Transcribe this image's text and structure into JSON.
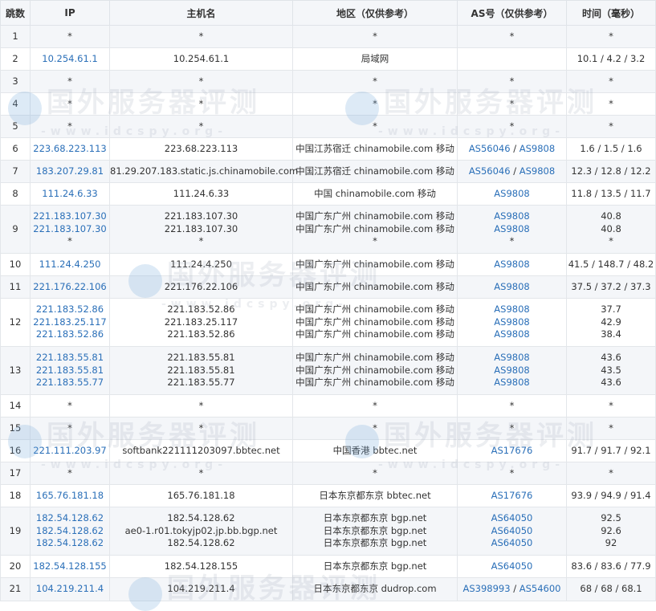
{
  "headers": [
    "跳数",
    "IP",
    "主机名",
    "地区（仅供参考）",
    "AS号（仅供参考）",
    "时间（毫秒）"
  ],
  "watermark": {
    "title": "国外服务器评测",
    "url": "-www.idcspy.org-"
  },
  "rows": [
    {
      "hop": "1",
      "ips": [
        "*"
      ],
      "hosts": [
        "*"
      ],
      "regions": [
        "*"
      ],
      "as": [
        [
          "*"
        ]
      ],
      "time": [
        "*"
      ]
    },
    {
      "hop": "2",
      "ips": [
        "10.254.61.1"
      ],
      "hosts": [
        "10.254.61.1"
      ],
      "regions": [
        "局域网"
      ],
      "as": [
        [
          ""
        ]
      ],
      "time": [
        "10.1 / 4.2 / 3.2"
      ]
    },
    {
      "hop": "3",
      "ips": [
        "*"
      ],
      "hosts": [
        "*"
      ],
      "regions": [
        "*"
      ],
      "as": [
        [
          "*"
        ]
      ],
      "time": [
        "*"
      ]
    },
    {
      "hop": "4",
      "ips": [
        "*"
      ],
      "hosts": [
        "*"
      ],
      "regions": [
        "*"
      ],
      "as": [
        [
          "*"
        ]
      ],
      "time": [
        "*"
      ]
    },
    {
      "hop": "5",
      "ips": [
        "*"
      ],
      "hosts": [
        "*"
      ],
      "regions": [
        "*"
      ],
      "as": [
        [
          "*"
        ]
      ],
      "time": [
        "*"
      ]
    },
    {
      "hop": "6",
      "ips": [
        "223.68.223.113"
      ],
      "hosts": [
        "223.68.223.113"
      ],
      "regions": [
        "中国江苏宿迁 chinamobile.com 移动"
      ],
      "as": [
        [
          "AS56046",
          "AS9808"
        ]
      ],
      "time": [
        "1.6 / 1.5 / 1.6"
      ]
    },
    {
      "hop": "7",
      "ips": [
        "183.207.29.81"
      ],
      "hosts": [
        "81.29.207.183.static.js.chinamobile.com"
      ],
      "regions": [
        "中国江苏宿迁 chinamobile.com 移动"
      ],
      "as": [
        [
          "AS56046",
          "AS9808"
        ]
      ],
      "time": [
        "12.3 / 12.8 / 12.2"
      ]
    },
    {
      "hop": "8",
      "ips": [
        "111.24.6.33"
      ],
      "hosts": [
        "111.24.6.33"
      ],
      "regions": [
        "中国 chinamobile.com 移动"
      ],
      "as": [
        [
          "AS9808"
        ]
      ],
      "time": [
        "11.8 / 13.5 / 11.7"
      ]
    },
    {
      "hop": "9",
      "ips": [
        "221.183.107.30",
        "221.183.107.30",
        "*"
      ],
      "hosts": [
        "221.183.107.30",
        "221.183.107.30",
        "*"
      ],
      "regions": [
        "中国广东广州 chinamobile.com 移动",
        "中国广东广州 chinamobile.com 移动",
        "*"
      ],
      "as": [
        [
          "AS9808"
        ],
        [
          "AS9808"
        ],
        [
          "*"
        ]
      ],
      "time": [
        "40.8",
        "40.8",
        "*"
      ]
    },
    {
      "hop": "10",
      "ips": [
        "111.24.4.250"
      ],
      "hosts": [
        "111.24.4.250"
      ],
      "regions": [
        "中国广东广州 chinamobile.com 移动"
      ],
      "as": [
        [
          "AS9808"
        ]
      ],
      "time": [
        "41.5 / 148.7 / 48.2"
      ]
    },
    {
      "hop": "11",
      "ips": [
        "221.176.22.106"
      ],
      "hosts": [
        "221.176.22.106"
      ],
      "regions": [
        "中国广东广州 chinamobile.com 移动"
      ],
      "as": [
        [
          "AS9808"
        ]
      ],
      "time": [
        "37.5 / 37.2 / 37.3"
      ]
    },
    {
      "hop": "12",
      "ips": [
        "221.183.52.86",
        "221.183.25.117",
        "221.183.52.86"
      ],
      "hosts": [
        "221.183.52.86",
        "221.183.25.117",
        "221.183.52.86"
      ],
      "regions": [
        "中国广东广州 chinamobile.com 移动",
        "中国广东广州 chinamobile.com 移动",
        "中国广东广州 chinamobile.com 移动"
      ],
      "as": [
        [
          "AS9808"
        ],
        [
          "AS9808"
        ],
        [
          "AS9808"
        ]
      ],
      "time": [
        "37.7",
        "42.9",
        "38.4"
      ]
    },
    {
      "hop": "13",
      "ips": [
        "221.183.55.81",
        "221.183.55.81",
        "221.183.55.77"
      ],
      "hosts": [
        "221.183.55.81",
        "221.183.55.81",
        "221.183.55.77"
      ],
      "regions": [
        "中国广东广州 chinamobile.com 移动",
        "中国广东广州 chinamobile.com 移动",
        "中国广东广州 chinamobile.com 移动"
      ],
      "as": [
        [
          "AS9808"
        ],
        [
          "AS9808"
        ],
        [
          "AS9808"
        ]
      ],
      "time": [
        "43.6",
        "43.5",
        "43.6"
      ]
    },
    {
      "hop": "14",
      "ips": [
        "*"
      ],
      "hosts": [
        "*"
      ],
      "regions": [
        "*"
      ],
      "as": [
        [
          "*"
        ]
      ],
      "time": [
        "*"
      ]
    },
    {
      "hop": "15",
      "ips": [
        "*"
      ],
      "hosts": [
        "*"
      ],
      "regions": [
        "*"
      ],
      "as": [
        [
          "*"
        ]
      ],
      "time": [
        "*"
      ]
    },
    {
      "hop": "16",
      "ips": [
        "221.111.203.97"
      ],
      "hosts": [
        "softbank221111203097.bbtec.net"
      ],
      "regions": [
        "中国香港 bbtec.net"
      ],
      "as": [
        [
          "AS17676"
        ]
      ],
      "time": [
        "91.7 / 91.7 / 92.1"
      ]
    },
    {
      "hop": "17",
      "ips": [
        "*"
      ],
      "hosts": [
        "*"
      ],
      "regions": [
        "*"
      ],
      "as": [
        [
          "*"
        ]
      ],
      "time": [
        "*"
      ]
    },
    {
      "hop": "18",
      "ips": [
        "165.76.181.18"
      ],
      "hosts": [
        "165.76.181.18"
      ],
      "regions": [
        "日本东京都东京 bbtec.net"
      ],
      "as": [
        [
          "AS17676"
        ]
      ],
      "time": [
        "93.9 / 94.9 / 91.4"
      ]
    },
    {
      "hop": "19",
      "ips": [
        "182.54.128.62",
        "182.54.128.62",
        "182.54.128.62"
      ],
      "hosts": [
        "182.54.128.62",
        "ae0-1.r01.tokyjp02.jp.bb.bgp.net",
        "182.54.128.62"
      ],
      "regions": [
        "日本东京都东京 bgp.net",
        "日本东京都东京 bgp.net",
        "日本东京都东京 bgp.net"
      ],
      "as": [
        [
          "AS64050"
        ],
        [
          "AS64050"
        ],
        [
          "AS64050"
        ]
      ],
      "time": [
        "92.5",
        "92.6",
        "92"
      ]
    },
    {
      "hop": "20",
      "ips": [
        "182.54.128.155"
      ],
      "hosts": [
        "182.54.128.155"
      ],
      "regions": [
        "日本东京都东京 bgp.net"
      ],
      "as": [
        [
          "AS64050"
        ]
      ],
      "time": [
        "83.6 / 83.6 / 77.9"
      ]
    },
    {
      "hop": "21",
      "ips": [
        "104.219.211.4"
      ],
      "hosts": [
        "104.219.211.4"
      ],
      "regions": [
        "日本东京都东京 dudrop.com"
      ],
      "as": [
        [
          "AS398993",
          "AS54600"
        ]
      ],
      "time": [
        "68 / 68 / 68.1"
      ]
    }
  ]
}
